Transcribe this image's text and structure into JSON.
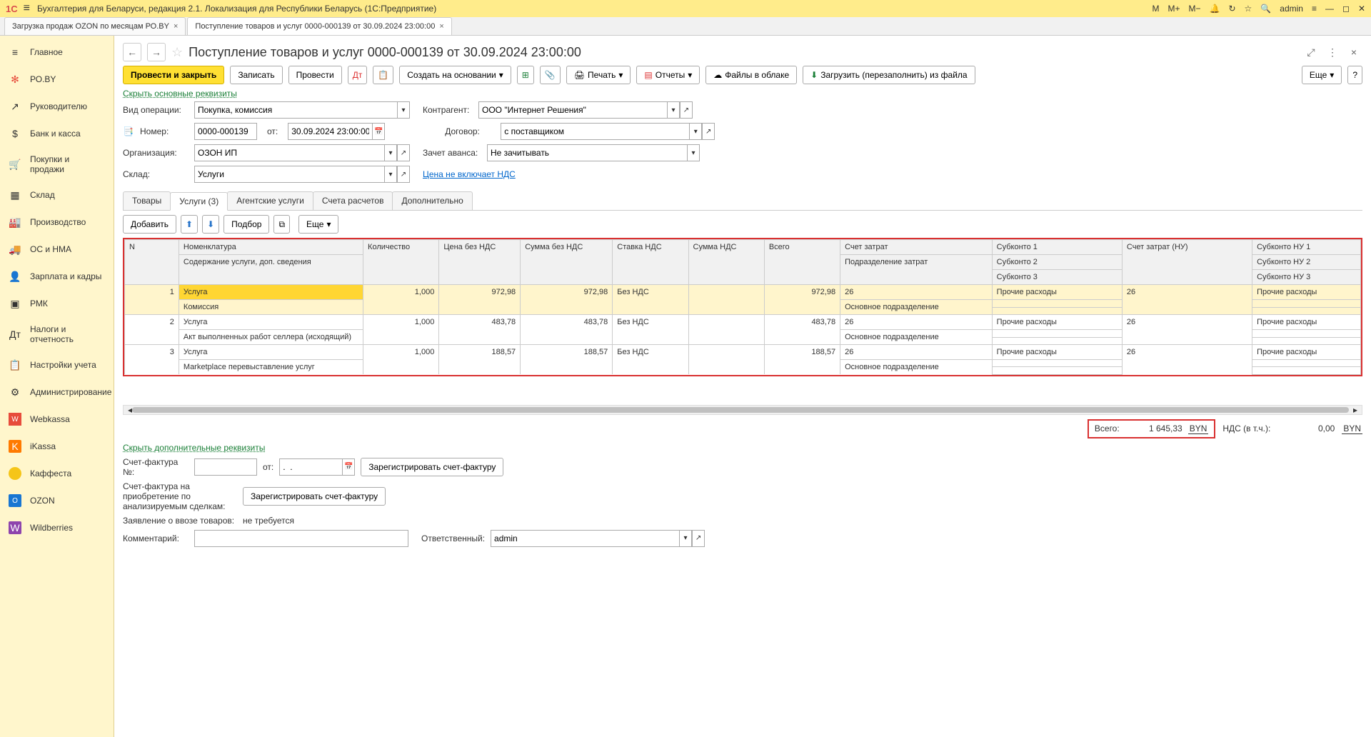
{
  "titlebar": {
    "app_logo": "1С",
    "app_title": "Бухгалтерия для Беларуси, редакция 2.1. Локализация для Республики Беларусь   (1С:Предприятие)",
    "right": {
      "m": "M",
      "mplus": "M+",
      "mminus": "M−",
      "user": "admin"
    }
  },
  "app_tabs": [
    {
      "label": "Загрузка продаж OZON по месяцам РО.ВY",
      "active": false
    },
    {
      "label": "Поступление товаров и услуг 0000-000139 от 30.09.2024 23:00:00",
      "active": true
    }
  ],
  "sidebar": [
    {
      "icon": "≡",
      "label": "Главное"
    },
    {
      "icon": "✻",
      "label": "РО.ВY"
    },
    {
      "icon": "↗",
      "label": "Руководителю"
    },
    {
      "icon": "$",
      "label": "Банк и касса"
    },
    {
      "icon": "🛒",
      "label": "Покупки и продажи"
    },
    {
      "icon": "▦",
      "label": "Склад"
    },
    {
      "icon": "🏭",
      "label": "Производство"
    },
    {
      "icon": "🚚",
      "label": "ОС и НМА"
    },
    {
      "icon": "👤",
      "label": "Зарплата и кадры"
    },
    {
      "icon": "▣",
      "label": "РМК"
    },
    {
      "icon": "Aₜ",
      "label": "Налоги и отчетность"
    },
    {
      "icon": "📄",
      "label": "Настройки учета"
    },
    {
      "icon": "⚙",
      "label": "Администрирование"
    },
    {
      "icon": "W",
      "label": "Webkassa",
      "bg": "square-red"
    },
    {
      "icon": "K",
      "label": "iKassa",
      "bg": "square-orange"
    },
    {
      "icon": "",
      "label": "Каффеста",
      "bg": "circle-yellow"
    },
    {
      "icon": "O",
      "label": "OZON",
      "bg": "square-blue"
    },
    {
      "icon": "W",
      "label": "Wildberries",
      "bg": "square-purple"
    }
  ],
  "page": {
    "title": "Поступление товаров и услуг 0000-000139 от 30.09.2024 23:00:00"
  },
  "toolbar": {
    "post_close": "Провести и закрыть",
    "save": "Записать",
    "post": "Провести",
    "create_on_basis": "Создать на основании",
    "print": "Печать",
    "reports": "Отчеты",
    "files": "Файлы в облаке",
    "load": "Загрузить (перезаполнить) из файла",
    "more": "Еще",
    "help": "?"
  },
  "collapse_main": "Скрыть основные реквизиты",
  "form": {
    "operation_type_label": "Вид операции:",
    "operation_type": "Покупка, комиссия",
    "number_label": "Номер:",
    "number": "0000-000139",
    "from_label": "от:",
    "date": "30.09.2024 23:00:00",
    "org_label": "Организация:",
    "org": "ОЗОН ИП",
    "warehouse_label": "Склад:",
    "warehouse": "Услуги",
    "counterparty_label": "Контрагент:",
    "counterparty": "ООО \"Интернет Решения\"",
    "contract_label": "Договор:",
    "contract": "с поставщиком",
    "advance_label": "Зачет аванса:",
    "advance": "Не зачитывать",
    "price_link": "Цена не включает НДС"
  },
  "doc_tabs": [
    "Товары",
    "Услуги (3)",
    "Агентские услуги",
    "Счета расчетов",
    "Дополнительно"
  ],
  "sub_toolbar": {
    "add": "Добавить",
    "pick": "Подбор",
    "more": "Еще"
  },
  "table": {
    "headers": {
      "n": "N",
      "nomen": "Номенклатура",
      "nomen2": "Содержание услуги, доп. сведения",
      "qty": "Количество",
      "price": "Цена без НДС",
      "sum": "Сумма без НДС",
      "vatrate": "Ставка НДС",
      "vatsum": "Сумма НДС",
      "total": "Всего",
      "cost_acc": "Счет затрат",
      "cost_acc2": "Подразделение затрат",
      "sub1": "Субконто 1",
      "sub2": "Субконто 2",
      "sub3": "Субконто 3",
      "cost_nu": "Счет затрат (НУ)",
      "subnu1": "Субконто НУ 1",
      "subnu2": "Субконто НУ 2",
      "subnu3": "Субконто НУ 3"
    },
    "rows": [
      {
        "n": "1",
        "nomen": "Услуга",
        "desc": "Комиссия",
        "qty": "1,000",
        "price": "972,98",
        "sum": "972,98",
        "vatrate": "Без НДС",
        "vatsum": "",
        "total": "972,98",
        "cost_acc": "26",
        "dept": "Основное подразделение",
        "sub1": "Прочие расходы",
        "cost_nu": "26",
        "subnu1": "Прочие расходы",
        "highlight": true
      },
      {
        "n": "2",
        "nomen": "Услуга",
        "desc": "Акт выполненных работ селлера (исходящий)",
        "qty": "1,000",
        "price": "483,78",
        "sum": "483,78",
        "vatrate": "Без НДС",
        "vatsum": "",
        "total": "483,78",
        "cost_acc": "26",
        "dept": "Основное подразделение",
        "sub1": "Прочие расходы",
        "cost_nu": "26",
        "subnu1": "Прочие расходы"
      },
      {
        "n": "3",
        "nomen": "Услуга",
        "desc": "Marketplace перевыставление услуг",
        "qty": "1,000",
        "price": "188,57",
        "sum": "188,57",
        "vatrate": "Без НДС",
        "vatsum": "",
        "total": "188,57",
        "cost_acc": "26",
        "dept": "Основное подразделение",
        "sub1": "Прочие расходы",
        "cost_nu": "26",
        "subnu1": "Прочие расходы"
      }
    ]
  },
  "totals": {
    "total_label": "Всего:",
    "total_value": "1 645,33",
    "currency": "BYN",
    "vat_label": "НДС (в т.ч.):",
    "vat_value": "0,00"
  },
  "collapse_extra": "Скрыть дополнительные реквизиты",
  "bottom": {
    "sf_no_label": "Счет-фактура №:",
    "sf_from": "от:",
    "sf_date": ".  .",
    "reg_sf": "Зарегистрировать счет-фактуру",
    "sf_acq_label": "Счет-фактура на приобретение по анализируемым сделкам:",
    "import_label": "Заявление о ввозе товаров:",
    "import_value": "не требуется",
    "comment_label": "Комментарий:",
    "responsible_label": "Ответственный:",
    "responsible_value": "admin"
  }
}
